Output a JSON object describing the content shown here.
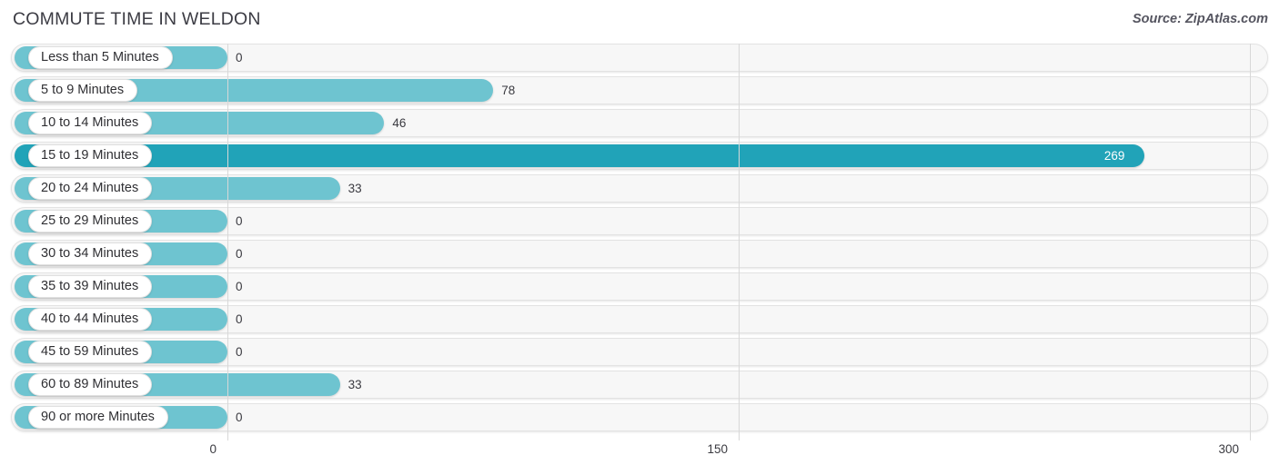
{
  "header": {
    "title": "COMMUTE TIME IN WELDON",
    "source": "Source: ZipAtlas.com"
  },
  "chart_data": {
    "type": "bar",
    "orientation": "horizontal",
    "title": "COMMUTE TIME IN WELDON",
    "xlabel": "",
    "ylabel": "",
    "xlim": [
      0,
      300
    ],
    "ticks": [
      0,
      150,
      300
    ],
    "tick_labels": [
      "0",
      "150",
      "300"
    ],
    "grid": true,
    "legend": "none",
    "categories": [
      "Less than 5 Minutes",
      "5 to 9 Minutes",
      "10 to 14 Minutes",
      "15 to 19 Minutes",
      "20 to 24 Minutes",
      "25 to 29 Minutes",
      "30 to 34 Minutes",
      "35 to 39 Minutes",
      "40 to 44 Minutes",
      "45 to 59 Minutes",
      "60 to 89 Minutes",
      "90 or more Minutes"
    ],
    "values": [
      0,
      78,
      46,
      269,
      33,
      0,
      0,
      0,
      0,
      0,
      33,
      0
    ],
    "value_labels": [
      "0",
      "78",
      "46",
      "269",
      "33",
      "0",
      "0",
      "0",
      "0",
      "0",
      "33",
      "0"
    ],
    "highlight_index": 3,
    "colors": {
      "bar": "#6ec4d0",
      "bar_highlight": "#21a3b8",
      "track": "#f7f7f7",
      "gridline": "#d8d8d8",
      "text": "#3a3a40",
      "value_inside": "#ffffff"
    }
  }
}
